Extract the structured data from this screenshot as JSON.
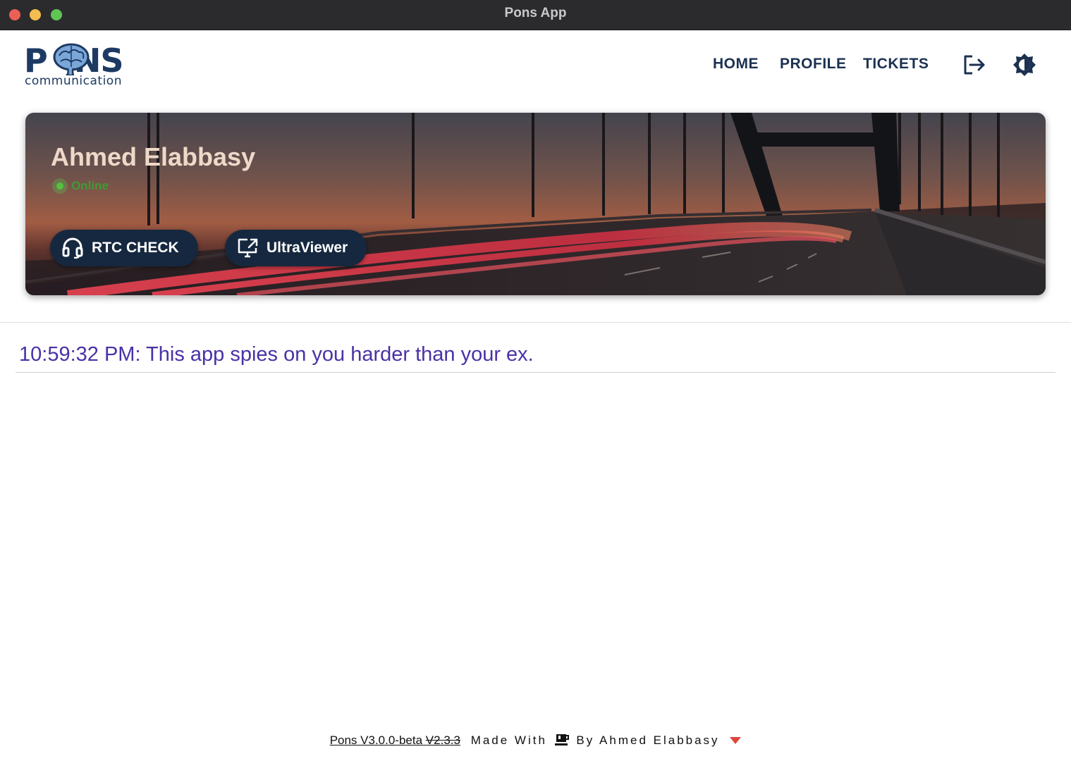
{
  "window": {
    "title": "Pons App"
  },
  "header": {
    "logo": {
      "word": "PONS",
      "subtitle": "communication",
      "icon": "brain-icon"
    },
    "nav": [
      {
        "label": "HOME"
      },
      {
        "label": "PROFILE"
      },
      {
        "label": "TICKETS"
      }
    ],
    "icons": {
      "logout": "logout-icon",
      "theme": "brightness-icon"
    }
  },
  "banner": {
    "user_name": "Ahmed Elabbasy",
    "status": "Online",
    "status_color": "#52c23f",
    "buttons": [
      {
        "label": "RTC CHECK",
        "icon": "headset-icon"
      },
      {
        "label": "UltraViewer",
        "icon": "remote-screen-icon"
      }
    ]
  },
  "messages": [
    {
      "text": "10:59:32 PM: This app spies on you harder than your ex."
    }
  ],
  "footer": {
    "app_name_version": "Pons V3.0.0-beta",
    "old_version": "V2.3.3",
    "made_with": "Made With",
    "by": "By Ahmed Elabbasy",
    "icon": "coffee-icon",
    "toggle_icon": "caret-down-icon"
  },
  "colors": {
    "accent": "#1d3a63",
    "message": "#4a31a6",
    "button_bg": "#16283f",
    "caret": "#e0463c"
  }
}
